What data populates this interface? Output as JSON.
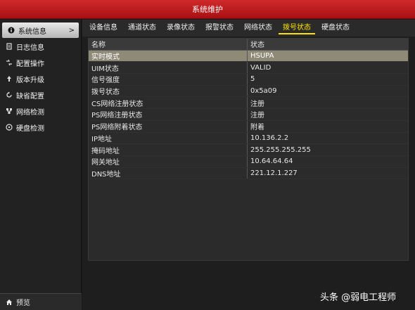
{
  "window": {
    "title": "系统维护"
  },
  "sidebar": {
    "items": [
      {
        "label": "系统信息",
        "icon": "info-icon"
      },
      {
        "label": "日志信息",
        "icon": "log-icon"
      },
      {
        "label": "配置操作",
        "icon": "config-icon"
      },
      {
        "label": "版本升级",
        "icon": "upgrade-icon"
      },
      {
        "label": "缺省配置",
        "icon": "reset-icon"
      },
      {
        "label": "网络检测",
        "icon": "network-icon"
      },
      {
        "label": "硬盘检测",
        "icon": "disk-check-icon"
      }
    ],
    "preview_label": "预览"
  },
  "tabs": [
    "设备信息",
    "通道状态",
    "录像状态",
    "报警状态",
    "网络状态",
    "拨号状态",
    "硬盘状态"
  ],
  "table": {
    "headers": {
      "name": "名称",
      "status": "状态"
    },
    "rows": [
      {
        "name": "实时模式",
        "status": "HSUPA"
      },
      {
        "name": "UIM状态",
        "status": "VALID"
      },
      {
        "name": "信号强度",
        "status": "5"
      },
      {
        "name": "拨号状态",
        "status": "0x5a09"
      },
      {
        "name": "CS网络注册状态",
        "status": "注册"
      },
      {
        "name": "PS网络注册状态",
        "status": "注册"
      },
      {
        "name": "PS网络附着状态",
        "status": "附着"
      },
      {
        "name": "IP地址",
        "status": "10.136.2.2"
      },
      {
        "name": "掩码地址",
        "status": "255.255.255.255"
      },
      {
        "name": "网关地址",
        "status": "10.64.64.64"
      },
      {
        "name": "DNS地址",
        "status": "221.12.1.227"
      }
    ]
  },
  "watermark": "头条 @弱电工程师",
  "colors": {
    "title_bar": "#b8161a",
    "active_tab": "#ffe400",
    "selected_row": "#8f8a78"
  }
}
